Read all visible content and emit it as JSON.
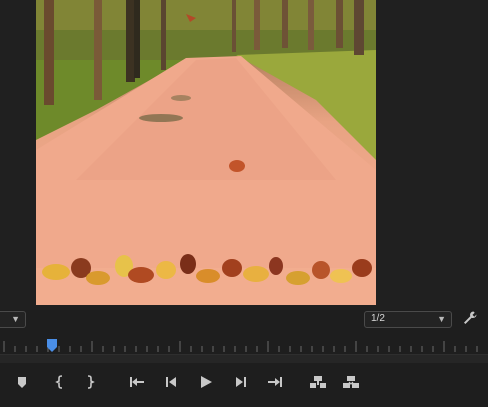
{
  "program_monitor": {
    "resolution": {
      "selected": "1/2"
    },
    "icons": {
      "zoom_dropdown": "chevron-down-icon",
      "resolution_dropdown": "chevron-down-icon",
      "settings": "wrench-icon",
      "playhead": "playhead-icon"
    }
  },
  "transport": {
    "buttons": [
      {
        "name": "add-marker-button",
        "icon": "marker-icon"
      },
      {
        "name": "mark-in-button",
        "icon": "mark-in-icon"
      },
      {
        "name": "mark-out-button",
        "icon": "mark-out-icon"
      },
      {
        "name": "go-to-in-button",
        "icon": "go-to-in-icon"
      },
      {
        "name": "step-back-button",
        "icon": "step-back-icon"
      },
      {
        "name": "play-button",
        "icon": "play-icon"
      },
      {
        "name": "step-forward-button",
        "icon": "step-forward-icon"
      },
      {
        "name": "go-to-out-button",
        "icon": "go-to-out-icon"
      },
      {
        "name": "lift-button",
        "icon": "lift-icon"
      },
      {
        "name": "extract-button",
        "icon": "extract-icon"
      }
    ]
  },
  "colors": {
    "panel_bg": "#1e1e1e",
    "playhead": "#4a8ee6",
    "icon": "#c8c8c8"
  }
}
